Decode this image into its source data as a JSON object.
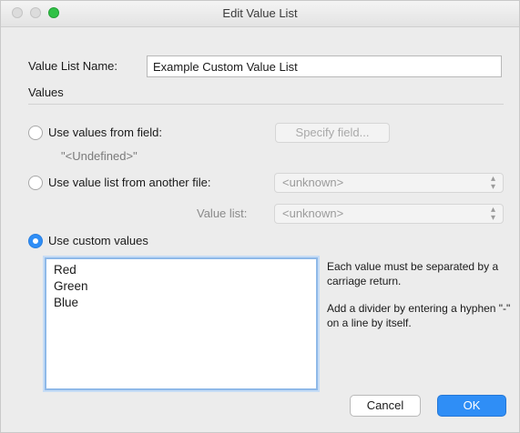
{
  "window": {
    "title": "Edit Value List"
  },
  "name_field": {
    "label": "Value List Name:",
    "value": "Example Custom Value List"
  },
  "values_section": {
    "heading": "Values"
  },
  "options": {
    "from_field": {
      "label": "Use values from field:",
      "button": "Specify field...",
      "field_value": "\"<Undefined>\"",
      "selected": false
    },
    "from_file": {
      "label": "Use value list from another file:",
      "file_select": "<unknown>",
      "value_list_label": "Value list:",
      "value_list_select": "<unknown>",
      "selected": false
    },
    "custom": {
      "label": "Use custom values",
      "selected": true,
      "values": [
        "Red",
        "Green",
        "Blue"
      ],
      "help_1": "Each value must be separated by a carriage return.",
      "help_2": "Add a divider by entering a hyphen \"-\" on a line by itself."
    }
  },
  "buttons": {
    "cancel": "Cancel",
    "ok": "OK"
  },
  "colors": {
    "accent": "#2f8ef6",
    "zoom_button": "#30c146"
  }
}
